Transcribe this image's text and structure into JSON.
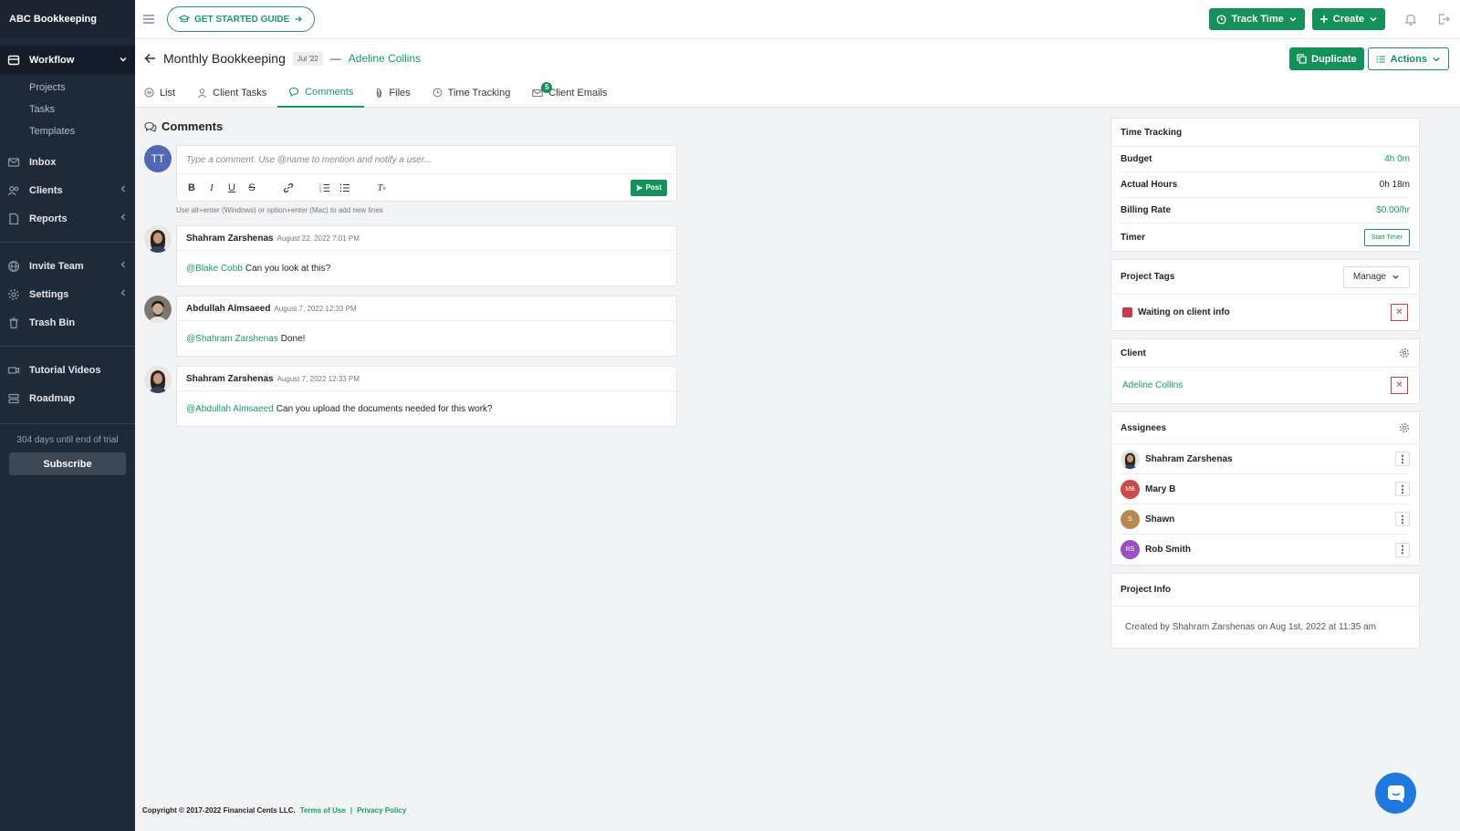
{
  "brand": "ABC Bookkeeping",
  "sidebar": {
    "workflow_label": "Workflow",
    "workflow_sub": [
      "Projects",
      "Tasks",
      "Templates"
    ],
    "inbox": "Inbox",
    "clients": "Clients",
    "reports": "Reports",
    "invite_team": "Invite Team",
    "settings": "Settings",
    "trash_bin": "Trash Bin",
    "tutorial_videos": "Tutorial Videos",
    "roadmap": "Roadmap",
    "trial_text": "304 days until end of trial",
    "subscribe": "Subscribe"
  },
  "topbar": {
    "guide_label": "GET STARTED GUIDE",
    "track_time": "Track Time",
    "create": "Create"
  },
  "project": {
    "title": "Monthly Bookkeeping",
    "date_badge": "Jul '22",
    "dash": "—",
    "client": "Adeline Collins",
    "duplicate": "Duplicate",
    "actions": "Actions"
  },
  "tabs": [
    {
      "label": "List"
    },
    {
      "label": "Client Tasks"
    },
    {
      "label": "Comments"
    },
    {
      "label": "Files"
    },
    {
      "label": "Time Tracking"
    },
    {
      "label": "Client Emails",
      "badge": "5"
    }
  ],
  "comments_section": {
    "title": "Comments",
    "user_initials": "TT",
    "placeholder": "Type a comment. Use @name to mention and notify a user...",
    "post": "Post",
    "hint": "Use alt+enter (Windows) or option+enter (Mac) to add new lines",
    "items": [
      {
        "author": "Shahram Zarshenas",
        "date": "August 22, 2022 7:01 PM",
        "mention": "@Blake Cobb",
        "text": "Can you look at this?"
      },
      {
        "author": "Abdullah Almsaeed",
        "date": "August 7, 2022 12:33 PM",
        "mention": "@Shahram Zarshenas",
        "text": "Done!"
      },
      {
        "author": "Shahram Zarshenas",
        "date": "August 7, 2022 12:33 PM",
        "mention": "@Abdullah Almsaeed",
        "text": "Can you upload the documents needed for this work?"
      }
    ]
  },
  "time_tracking": {
    "title": "Time Tracking",
    "budget_label": "Budget",
    "budget_value": "4h 0m",
    "actual_label": "Actual Hours",
    "actual_value": "0h 18m",
    "rate_label": "Billing Rate",
    "rate_value": "$0.00/hr",
    "timer_label": "Timer",
    "start_timer": "Start Timer"
  },
  "project_tags": {
    "title": "Project Tags",
    "manage": "Manage",
    "tag": "Waiting on client info",
    "tag_color": "#c83a4a"
  },
  "client_panel": {
    "title": "Client",
    "name": "Adeline Collins"
  },
  "assignees": {
    "title": "Assignees",
    "items": [
      {
        "name": "Shahram Zarshenas",
        "initials": "",
        "color": "#3a3a3a"
      },
      {
        "name": "Mary B",
        "initials": "MB",
        "color": "#c94a4a"
      },
      {
        "name": "Shawn",
        "initials": "S",
        "color": "#b8894f"
      },
      {
        "name": "Rob Smith",
        "initials": "RS",
        "color": "#9b4fc0"
      }
    ]
  },
  "project_info": {
    "title": "Project Info",
    "created": "Created by Shahram Zarshenas on Aug 1st, 2022 at 11:35 am"
  },
  "footer": {
    "copyright": "Copyright © 2017-2022 Financial Cents LLC.",
    "terms": "Terms of Use",
    "sep": "|",
    "privacy": "Privacy Policy"
  },
  "colors": {
    "accent": "#14905a",
    "sidebar": "#1f2a37",
    "chat": "#1f7ae0"
  }
}
